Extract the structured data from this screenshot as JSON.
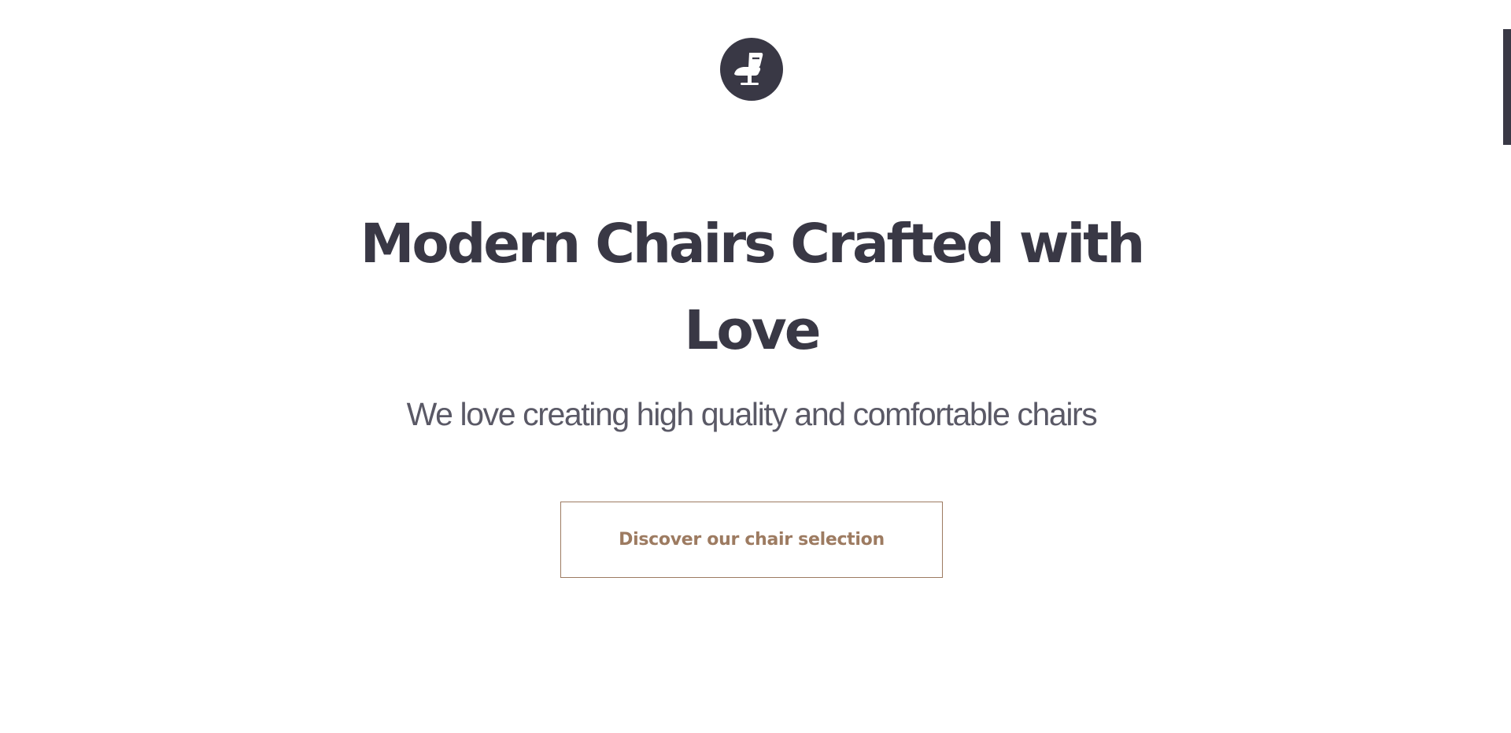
{
  "brand": {
    "logo_icon": "chair-icon",
    "logo_color": "#393845"
  },
  "hero": {
    "title": "Modern Chairs Crafted with Love",
    "subtitle": "We love creating high quality and comfortable chairs",
    "cta_label": "Discover our chair selection"
  },
  "colors": {
    "primary": "#393845",
    "accent": "#9d7b61",
    "background": "#ffffff"
  }
}
